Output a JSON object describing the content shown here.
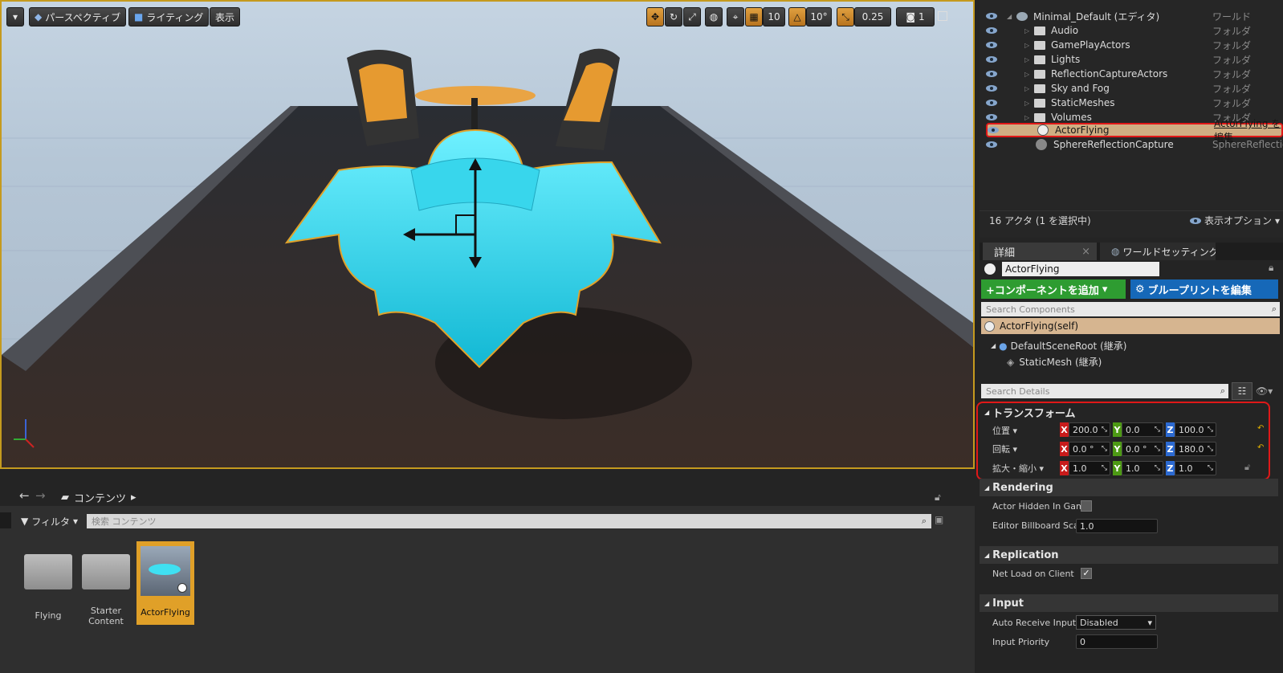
{
  "viewport": {
    "perspective": "パースペクティブ",
    "lighting": "ライティング",
    "show": "表示",
    "grid_snap": "10",
    "rot_snap": "10°",
    "scale_snap": "0.25",
    "cam_speed": "1"
  },
  "outliner": {
    "world_name": "Minimal_Default (エディタ)",
    "world_type": "ワールド",
    "folders": [
      "Audio",
      "GamePlayActors",
      "Lights",
      "ReflectionCaptureActors",
      "Sky and Fog",
      "StaticMeshes",
      "Volumes"
    ],
    "folder_type": "フォルダ",
    "selected_actor": "ActorFlying",
    "selected_type": "ActorFlying を編集",
    "other_actor": "SphereReflectionCapture",
    "other_type": "SphereReflectionC",
    "count": "16 アクタ (1 を選択中)",
    "view_options": "表示オプション"
  },
  "details": {
    "tab_details": "詳細",
    "tab_world": "ワールドセッティング",
    "actor_name": "ActorFlying",
    "add_component": "+コンポーネントを追加",
    "blueprint": "ブループリントを編集",
    "search_components": "Search Components",
    "self_row": "ActorFlying(self)",
    "root": "DefaultSceneRoot (継承)",
    "mesh": "StaticMesh (継承)",
    "search_details": "Search Details",
    "transform_title": "トランスフォーム",
    "location_label": "位置",
    "rotation_label": "回転",
    "scale_label": "拡大・縮小",
    "loc": {
      "x": "200.0",
      "y": "0.0",
      "z": "100.0"
    },
    "rot": {
      "x": "0.0 °",
      "y": "0.0 °",
      "z": "180.0"
    },
    "scl": {
      "x": "1.0",
      "y": "1.0",
      "z": "1.0"
    },
    "rendering": "Rendering",
    "hidden_label": "Actor Hidden In Game",
    "billboard_label": "Editor Billboard Scale",
    "billboard_val": "1.0",
    "replication": "Replication",
    "netload_label": "Net Load on Client",
    "input": "Input",
    "auto_label": "Auto Receive Input",
    "auto_val": "Disabled",
    "priority_label": "Input Priority",
    "priority_val": "0"
  },
  "content": {
    "path": "コンテンツ",
    "filter": "フィルタ",
    "search_placeholder": "検索 コンテンツ",
    "items": [
      "Flying",
      "Starter Content",
      "ActorFlying"
    ]
  }
}
